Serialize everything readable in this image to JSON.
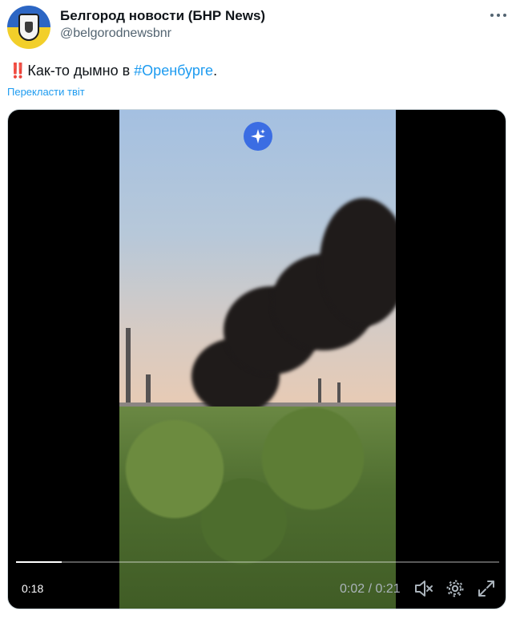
{
  "account": {
    "name": "Белгород новости (БНР News)",
    "handle": "@belgorodnewsbnr",
    "avatar_icon": "coat-of-arms-avatar"
  },
  "tweet": {
    "emoji": "‼️",
    "text_before": "Как-то дымно в ",
    "hashtag": "#Оренбурге",
    "text_after": ".",
    "translate_link": "Перекласти твіт"
  },
  "video": {
    "remaining": "0:18",
    "current_time": "0:02",
    "duration": "0:21",
    "time_separator": " / ",
    "progress_fraction": 0.095,
    "icons": {
      "ai": "sparkles-icon",
      "mute": "speaker-muted-icon",
      "settings": "gear-icon",
      "fullscreen": "fullscreen-icon"
    }
  },
  "colors": {
    "link": "#1d9bf0",
    "handle": "#536471",
    "alert": "#d7192f"
  }
}
